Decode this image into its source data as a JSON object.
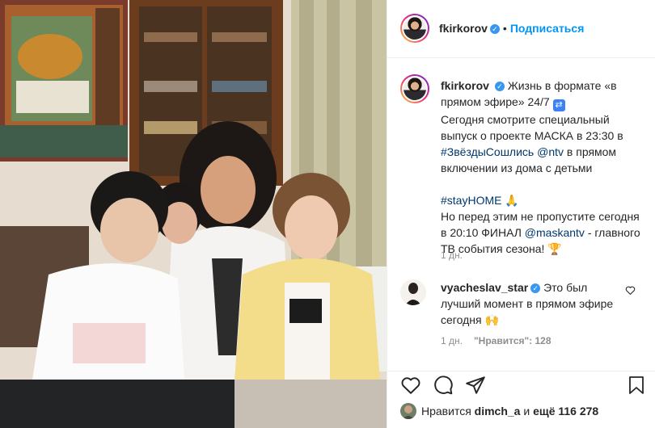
{
  "header": {
    "username": "fkirkorov",
    "separator": "•",
    "follow_label": "Подписаться"
  },
  "caption": {
    "username": "fkirkorov",
    "text_part1": "Жизнь в формате «в прямом эфире» 24/7",
    "text_part2": "Сегодня смотрите специальный выпуск о проекте МАСКА в 23:30 в",
    "hashtag1": "#ЗвёздыСошлись",
    "mention1": "@ntv",
    "text_part3": "в прямом включении из дома с детьми",
    "hashtag2": "#stayHOME",
    "text_part4": "Но перед этим не пропустите сегодня в 20:10 ФИНАЛ",
    "mention2": "@maskantv",
    "text_part5": "- главного ТВ события сезона!",
    "time": "1 дн."
  },
  "comment": {
    "username": "vyacheslav_star",
    "text": "Это был лучший момент в прямом эфире сегодня",
    "time": "1 дн.",
    "likes_label": "\"Нравится\": 128"
  },
  "likes": {
    "prefix": "Нравится",
    "user": "dimch_a",
    "middle": "и",
    "count_label": "ещё 116 278"
  },
  "icons": {
    "verified": "verified-badge-icon",
    "repeat": "repeat-emoji-icon",
    "praying": "praying-hands-emoji-icon",
    "trophy": "trophy-emoji-icon",
    "raised_hands": "raised-hands-emoji-icon",
    "like": "heart-icon",
    "comment": "comment-icon",
    "share": "paper-plane-icon",
    "save": "bookmark-icon"
  },
  "colors": {
    "follow": "#0095f6",
    "verified": "#3897f0",
    "link": "#00376b",
    "muted": "#8e8e8e"
  }
}
